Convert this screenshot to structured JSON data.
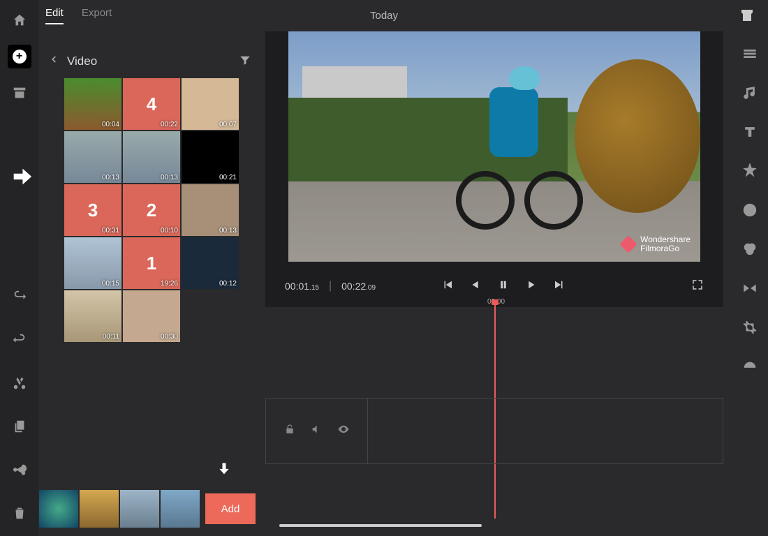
{
  "header": {
    "tabs": {
      "edit": "Edit",
      "export": "Export"
    },
    "date": "Today"
  },
  "picker": {
    "back": "‹",
    "title": "Video",
    "thumbs": [
      {
        "dur": "00:04",
        "selected": false
      },
      {
        "dur": "00:22",
        "selected": true,
        "order": "4"
      },
      {
        "dur": "00:07",
        "selected": false
      },
      {
        "dur": "00:13",
        "selected": false
      },
      {
        "dur": "00:13",
        "selected": false
      },
      {
        "dur": "00:21",
        "selected": false
      },
      {
        "dur": "00:31",
        "selected": true,
        "order": "3"
      },
      {
        "dur": "00:10",
        "selected": true,
        "order": "2"
      },
      {
        "dur": "00:13",
        "selected": false
      },
      {
        "dur": "00:15",
        "selected": false
      },
      {
        "dur": "19:26",
        "selected": true,
        "order": "1"
      },
      {
        "dur": "00:12",
        "selected": false
      },
      {
        "dur": "00:11",
        "selected": false
      },
      {
        "dur": "00:30",
        "selected": false
      }
    ]
  },
  "tray": {
    "add": "Add"
  },
  "preview": {
    "current": "00:01",
    "current_sub": ".15",
    "total": "00:22",
    "total_sub": ".09",
    "watermark_l1": "Wondershare",
    "watermark_l2": "FilmoraGo"
  },
  "timeline": {
    "playhead": "00:00"
  }
}
